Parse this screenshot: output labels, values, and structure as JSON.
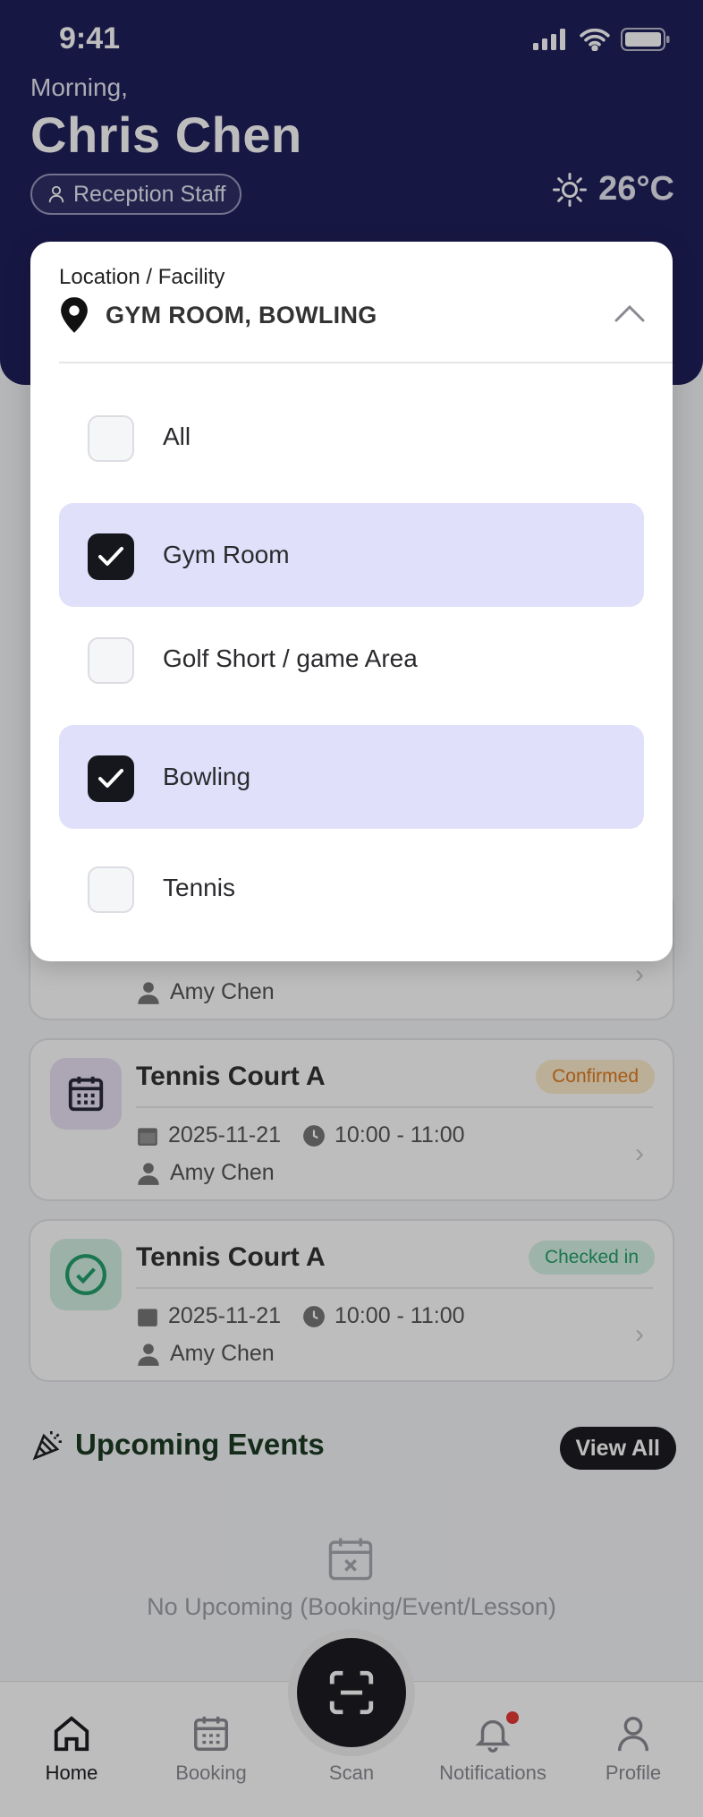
{
  "status_bar": {
    "time": "9:41"
  },
  "header": {
    "greeting": "Morning,",
    "name": "Chris Chen",
    "role": "Reception Staff",
    "temperature": "26°C"
  },
  "location_dropdown": {
    "label": "Location / Facility",
    "selected_value": "GYM ROOM, BOWLING",
    "options": [
      {
        "label": "All",
        "checked": false
      },
      {
        "label": "Gym Room",
        "checked": true
      },
      {
        "label": "Golf Short / game Area",
        "checked": false
      },
      {
        "label": "Bowling",
        "checked": true
      },
      {
        "label": "Tennis",
        "checked": false
      }
    ]
  },
  "bookings": [
    {
      "person": "Amy Chen"
    },
    {
      "title": "Tennis Court A",
      "status": "Confirmed",
      "date": "2025-11-21",
      "time": "10:00 - 11:00",
      "person": "Amy Chen",
      "status_color": "#e07a1f",
      "status_bg": "#fdeccc"
    },
    {
      "title": "Tennis Court A",
      "status": "Checked in",
      "date": "2025-11-21",
      "time": "10:00 - 11:00",
      "person": "Amy Chen",
      "status_color": "#22a06b",
      "status_bg": "#d6f3e6"
    }
  ],
  "upcoming_events": {
    "title": "Upcoming Events",
    "view_all": "View All",
    "empty_text": "No Upcoming (Booking/Event/Lesson)"
  },
  "tab_bar": {
    "tabs": [
      {
        "label": "Home",
        "icon": "home-icon",
        "active": true
      },
      {
        "label": "Booking",
        "icon": "calendar-icon",
        "active": false
      },
      {
        "label": "Scan",
        "icon": "scan-icon",
        "active": false
      },
      {
        "label": "Notifications",
        "icon": "bell-icon",
        "active": false
      },
      {
        "label": "Profile",
        "icon": "user-icon",
        "active": false
      }
    ]
  },
  "colors": {
    "header_bg": "#1f1f5c",
    "checked_option_bg": "#e0e0fa",
    "checkbox_checked": "#16161d"
  }
}
